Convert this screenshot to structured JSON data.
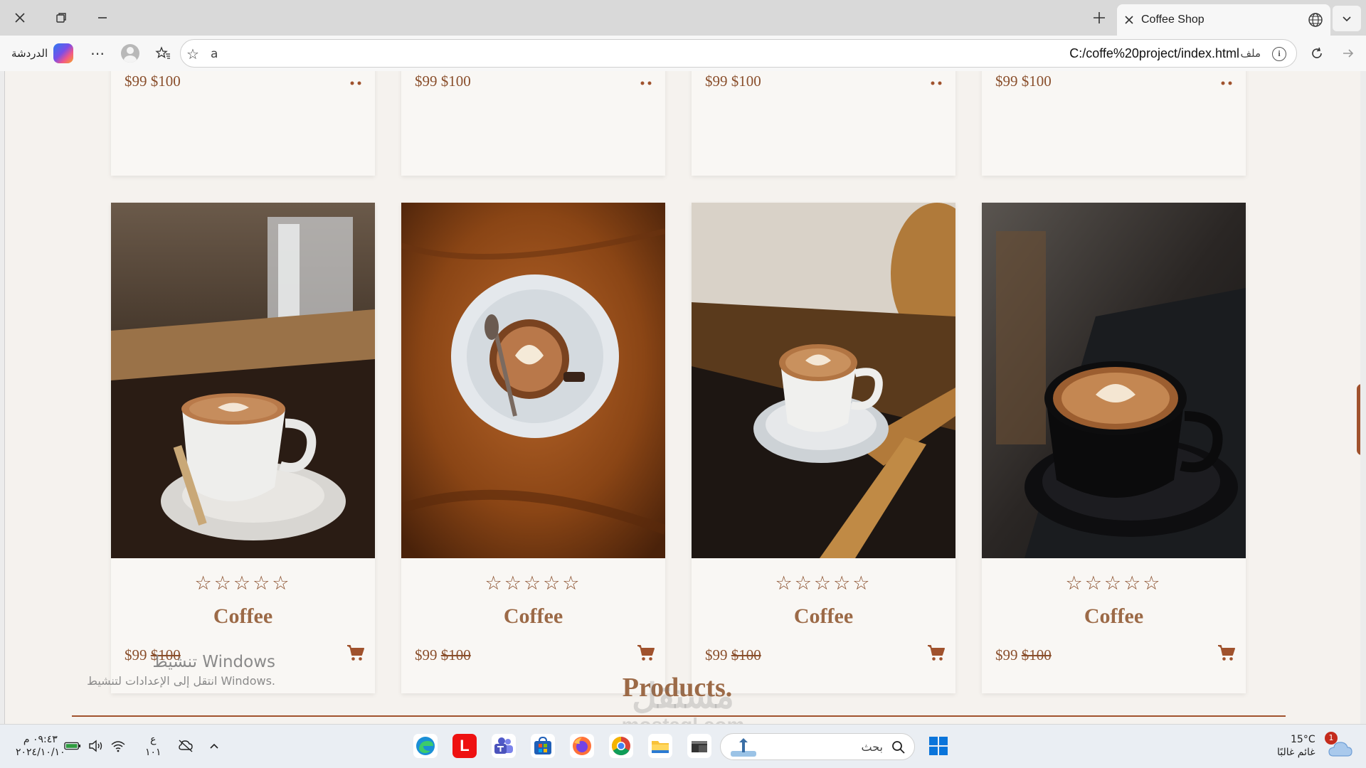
{
  "browser": {
    "tab_title": "Coffee Shop",
    "copilot_label": "الدردشة",
    "url": "C:/coffe%20project/index.html",
    "url_scheme_label": "ملف"
  },
  "page": {
    "prev_row_price": "$99 $100",
    "products": [
      {
        "name": "Coffee",
        "price": "$99",
        "old_price": "$100",
        "stars": "☆☆☆☆☆",
        "rating": 0
      },
      {
        "name": "Coffee",
        "price": "$99",
        "old_price": "$100",
        "stars": "☆☆☆☆☆",
        "rating": 0
      },
      {
        "name": "Coffee",
        "price": "$99",
        "old_price": "$100",
        "stars": "☆☆☆☆☆",
        "rating": 0
      },
      {
        "name": "Coffee",
        "price": "$99",
        "old_price": "$100",
        "stars": "☆☆☆☆☆",
        "rating": 0
      }
    ],
    "section_title": "Products.",
    "activation_title": "تنشيط Windows",
    "activation_subtitle": "انتقل إلى الإعدادات لتنشيط Windows.",
    "watermark_line1": "مستقل",
    "watermark_line2": "mostaql.com",
    "accent_color": "#a0522d"
  },
  "taskbar": {
    "time": "٠٩:٤٣ م",
    "date": "٢٠٢٤/١٠/١٠",
    "lang_line1": "ع",
    "lang_line2": "١٠١",
    "search_placeholder": "بحث",
    "temperature": "15°C",
    "weather_text": "غائم غالبًا",
    "notification_count": "1"
  },
  "icons": [
    "close-icon",
    "restore-icon",
    "minimize-icon",
    "new-tab-icon",
    "globe-icon",
    "chevron-down-icon",
    "more-icon",
    "favorites-icon",
    "star-icon",
    "read-aloud-icon",
    "info-icon",
    "refresh-icon",
    "forward-icon",
    "cart-icon",
    "search-icon",
    "windows-start-icon"
  ]
}
